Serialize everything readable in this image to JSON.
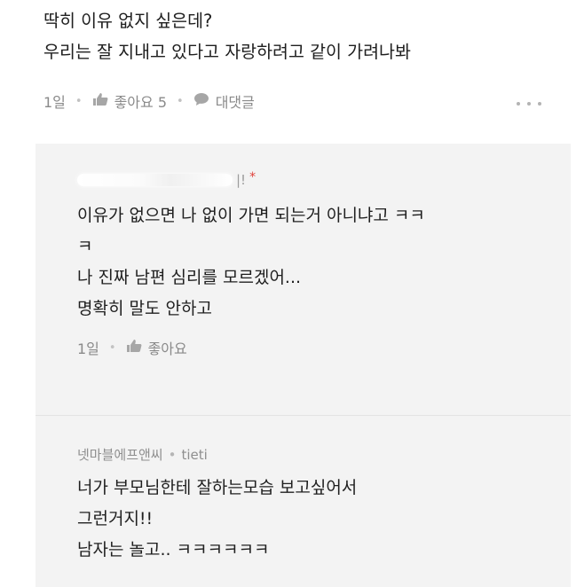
{
  "top_comment": {
    "lines": [
      "딱히 이유 없지 싶은데?",
      "우리는 잘 지내고 있다고 자랑하려고 같이 가려나봐"
    ],
    "time": "1일",
    "like_label": "좋아요 5",
    "reply_label": "대댓글"
  },
  "reply_1": {
    "author_tail": "|!",
    "new_marker": "*",
    "lines": [
      "이유가 없으면 나 없이 가면 되는거 아니냐고 ㅋㅋ",
      "ㅋ",
      "나 진짜 남편 심리를 모르겠어...",
      "명확히 말도 안하고"
    ],
    "time": "1일",
    "like_label": "좋아요"
  },
  "reply_2": {
    "author": "넷마블에프앤씨",
    "mention": "tieti",
    "lines": [
      "너가 부모님한테 잘하는모습 보고싶어서",
      "그런거지!!",
      "남자는 놀고.. ㅋㅋㅋㅋㅋㅋ"
    ]
  },
  "icons": [
    "thumbs-up-icon",
    "speech-bubble-icon",
    "more-options-icon"
  ],
  "colors": {
    "reply_background": "#f3f3f3",
    "meta_text": "#8a8a8a",
    "new_marker": "#e0413a"
  }
}
